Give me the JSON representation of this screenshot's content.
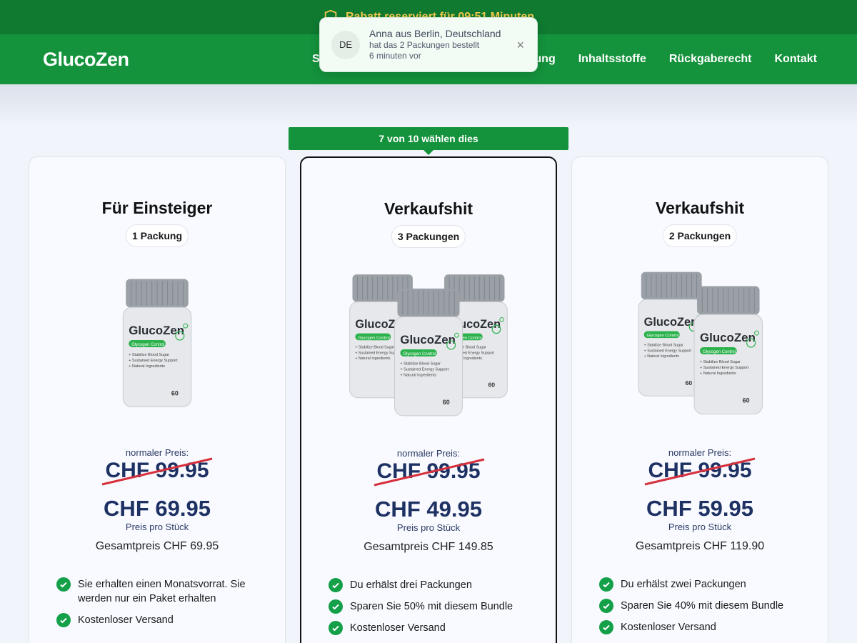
{
  "topbar": {
    "text": "Rabatt reserviert für 09:51 Minuten"
  },
  "brand": {
    "name": "GlucoZen"
  },
  "nav": {
    "hidden_item": "S",
    "items": [
      "Wirkung",
      "Inhaltsstoffe",
      "Rückgaberecht",
      "Kontakt"
    ]
  },
  "notification": {
    "country_code": "DE",
    "line1": "Anna aus Berlin, Deutschland",
    "line2": "hat das 2 Packungen bestellt",
    "line3": "6 minuten vor",
    "close": "×"
  },
  "featured_badge": "7 von 10 wählen dies",
  "product": {
    "bottle_brand": "GlucoZen",
    "bottle_tag": "Glycogen Control",
    "bottle_lines": [
      "Stabilize Blood Sugar",
      "Sustained Energy Support",
      "Natural Ingredients"
    ],
    "bottle_count": "60"
  },
  "plans": [
    {
      "title": "Für Einsteiger",
      "packs": "1 Packung",
      "regular_label": "normaler Preis:",
      "old_price": "CHF 99.95",
      "price": "CHF 69.95",
      "unit_label": "Preis pro Stück",
      "total": "Gesamtpreis CHF 69.95",
      "features": [
        "Sie erhalten einen Monatsvorrat. Sie werden nur ein Paket erhalten",
        "Kostenloser Versand"
      ]
    },
    {
      "title": "Verkaufshit",
      "packs": "3 Packungen",
      "regular_label": "normaler Preis:",
      "old_price": "CHF 99.95",
      "price": "CHF 49.95",
      "unit_label": "Preis pro Stück",
      "total": "Gesamtpreis CHF 149.85",
      "features": [
        "Du erhälst drei Packungen",
        "Sparen Sie 50% mit diesem Bundle",
        "Kostenloser Versand"
      ]
    },
    {
      "title": "Verkaufshit",
      "packs": "2 Packungen",
      "regular_label": "normaler Preis:",
      "old_price": "CHF 99.95",
      "price": "CHF 59.95",
      "unit_label": "Preis pro Stück",
      "total": "Gesamtpreis CHF 119.90",
      "features": [
        "Du erhälst zwei Packungen",
        "Sparen Sie 40% mit diesem Bundle",
        "Kostenloser Versand"
      ]
    }
  ],
  "colors": {
    "brand_green": "#14923c",
    "dark_green": "#0f7a30",
    "price_navy": "#1e3163",
    "strike_red": "#d6303d",
    "check_green": "#14a048"
  }
}
